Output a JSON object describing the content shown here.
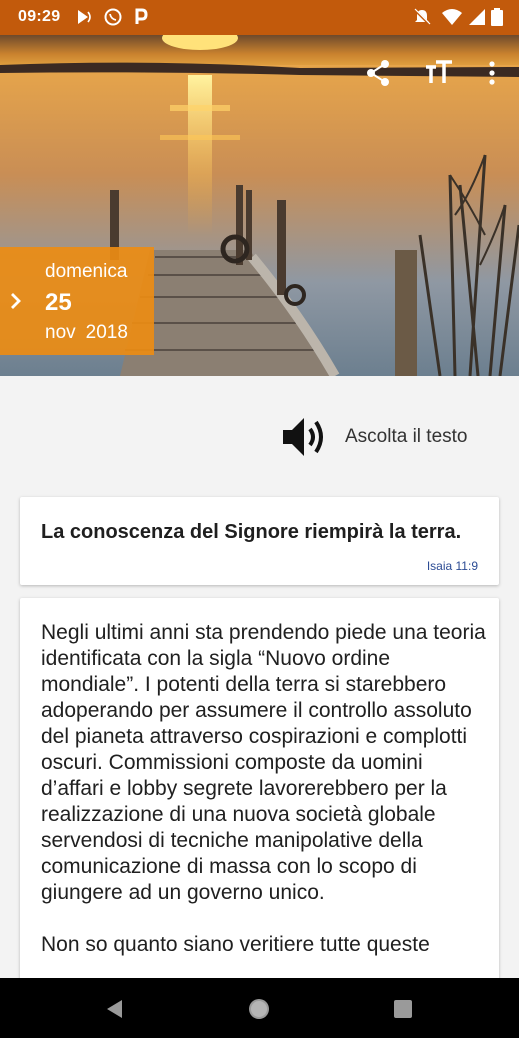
{
  "status_bar": {
    "time": "09:29",
    "left_icons": [
      "play-store-icon",
      "whatsapp-icon",
      "p-app-icon"
    ],
    "right_icons": [
      "mute-icon",
      "wifi-icon",
      "signal-icon",
      "battery-icon"
    ]
  },
  "header": {
    "actions": [
      "share-icon",
      "text-size-icon",
      "more-vert-icon"
    ],
    "date": {
      "weekday": "domenica",
      "day": "25",
      "month": "nov",
      "year": "2018"
    }
  },
  "audio": {
    "label": "Ascolta il testo"
  },
  "verse_card": {
    "title": "La conoscenza del Signore riempirà la terra.",
    "reference": "Isaia 11:9"
  },
  "reflection": {
    "paragraphs": [
      "Negli ultimi anni sta prendendo piede una teoria identificata con la sigla “Nuovo ordine mondiale”. I potenti della terra si starebbero adoperando per assumere il controllo assoluto del pianeta attraverso cospirazioni e complotti oscuri. Commissioni composte da uomini d’affari e lobby segrete lavorerebbero per la realizzazione di una nuova società globale servendosi di tecniche manipolative della comunicazione di massa con lo scopo di giungere ad un governo unico.",
      "Non so quanto siano veritiere tutte queste"
    ]
  },
  "nav_bar": {
    "buttons": [
      "back-icon",
      "home-icon",
      "recents-icon"
    ]
  },
  "colors": {
    "status_bar": "#c25a0c",
    "date_box": "#eb8c14",
    "reference": "#2b4b94"
  }
}
